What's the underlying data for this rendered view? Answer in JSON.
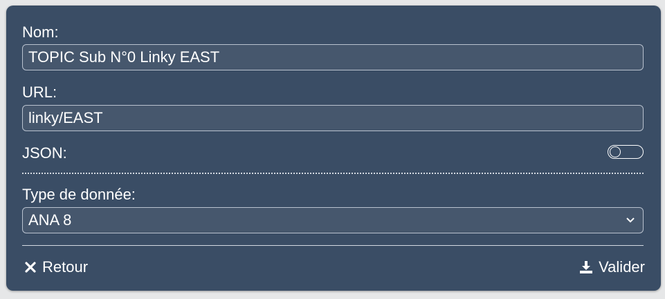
{
  "form": {
    "nom_label": "Nom:",
    "nom_value": "TOPIC Sub N°0 Linky EAST",
    "url_label": "URL:",
    "url_value": "linky/EAST",
    "json_label": "JSON:",
    "json_enabled": false,
    "type_label": "Type de donnée:",
    "type_value": "ANA 8"
  },
  "actions": {
    "back_label": "Retour",
    "back_icon": "close-icon",
    "submit_label": "Valider",
    "submit_icon": "download-icon"
  },
  "colors": {
    "panel_bg": "#3a4d65",
    "field_bg": "#46576d",
    "text": "#ffffff"
  }
}
